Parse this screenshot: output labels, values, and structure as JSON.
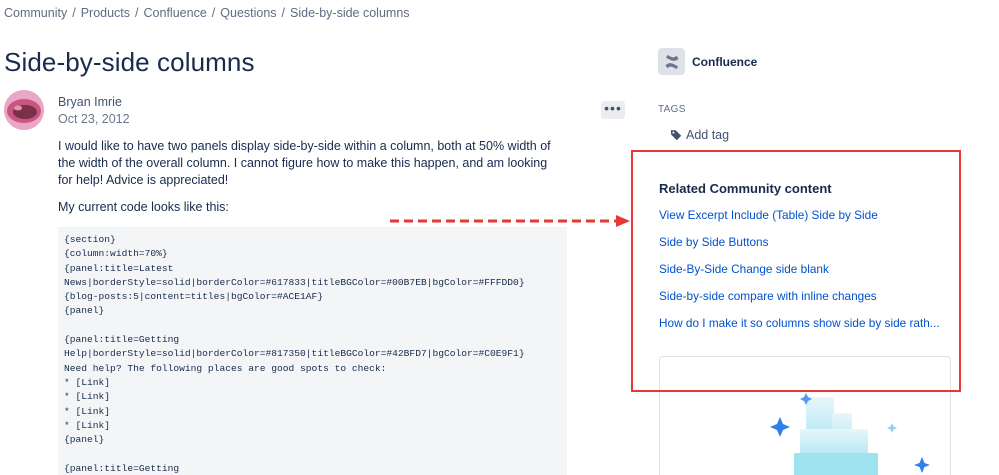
{
  "breadcrumb": [
    "Community",
    "Products",
    "Confluence",
    "Questions",
    "Side-by-side columns"
  ],
  "breadcrumb_separator": "/",
  "question": {
    "title": "Side-by-side columns",
    "author": "Bryan Imrie",
    "date": "Oct 23, 2012",
    "more_label": "•••",
    "paragraph1": "I would like to have two panels display side-by-side within a column, both at 50% width of the width of the overall column. I cannot figure how to make this happen, and am looking for help! Advice is appreciated!",
    "paragraph2": "My current code looks like this:",
    "code": "{section}\n{column:width=70%}\n{panel:title=Latest\nNews|borderStyle=solid|borderColor=#617833|titleBGColor=#00B7EB|bgColor=#FFFDD0}\n{blog-posts:5|content=titles|bgColor=#ACE1AF}\n{panel}\n\n{panel:title=Getting\nHelp|borderStyle=solid|borderColor=#817350|titleBGColor=#42BFD7|bgColor=#C0E9F1}\nNeed help? The following places are good spots to check:\n* [Link]\n* [Link]\n* [Link]\n* [Link]\n{panel}\n\n{panel:title=Getting"
  },
  "sidebar": {
    "product": "Confluence",
    "tags_heading": "TAGS",
    "add_tag": "Add tag",
    "related": {
      "heading": "Related Community content",
      "links": [
        "View Excerpt Include (Table) Side by Side",
        "Side by Side Buttons",
        "Side-By-Side Change side blank",
        "Side-by-side compare with inline changes",
        "How do I make it so columns show side by side rath..."
      ]
    }
  },
  "colors": {
    "link": "#0052cc",
    "highlight_border": "#e53935",
    "code_bg": "#f4f5f7"
  }
}
